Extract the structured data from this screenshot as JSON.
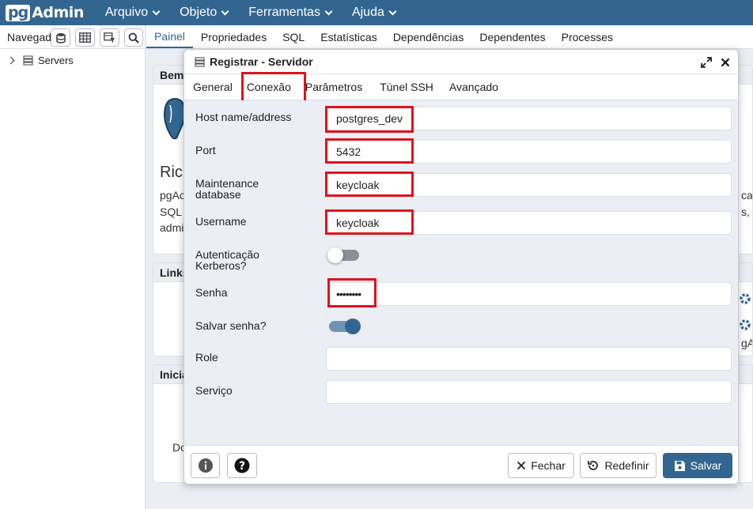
{
  "app": {
    "logo_pg": "pg",
    "logo_admin": "Admin"
  },
  "menu": [
    {
      "label": "Arquivo"
    },
    {
      "label": "Objeto"
    },
    {
      "label": "Ferramentas"
    },
    {
      "label": "Ajuda"
    }
  ],
  "browser": {
    "title": "Navegador",
    "tree": [
      {
        "label": "Servers",
        "icon": "server-group-icon",
        "expanded": false
      }
    ]
  },
  "main_tabs": [
    {
      "label": "Painel",
      "active": true
    },
    {
      "label": "Propriedades"
    },
    {
      "label": "SQL"
    },
    {
      "label": "Estatísticas"
    },
    {
      "label": "Dependências"
    },
    {
      "label": "Dependentes"
    },
    {
      "label": "Processes"
    }
  ],
  "dashboard": {
    "welcome_head": "Bem-",
    "welcome_big": "Ric",
    "welcome_lines": [
      "pgAc",
      "SQL",
      "admi"
    ],
    "welcome_right": [
      "cal",
      "s, l"
    ],
    "links_head": "Links",
    "links_right": "gA",
    "start_head": "Inicia",
    "start_bottom": "Do"
  },
  "dialog": {
    "title": "Registrar - Servidor",
    "tabs": [
      {
        "label": "General"
      },
      {
        "label": "Conexão",
        "active": true
      },
      {
        "label": "Parâmetros"
      },
      {
        "label": "Túnel SSH"
      },
      {
        "label": "Avançado"
      }
    ],
    "fields": {
      "host": {
        "label": "Host name/address",
        "value": "postgres_dev"
      },
      "port": {
        "label": "Port",
        "value": "5432"
      },
      "maintenance_db": {
        "label": "Maintenance database",
        "label_line1": "Maintenance",
        "label_line2": "database",
        "value": "keycloak"
      },
      "username": {
        "label": "Username",
        "value": "keycloak"
      },
      "kerberos": {
        "label": "Autenticação Kerberos?",
        "label_line1": "Autenticação",
        "label_line2": "Kerberos?",
        "checked": false
      },
      "password": {
        "label": "Senha",
        "value": "••••••••"
      },
      "save_password": {
        "label": "Salvar senha?",
        "checked": true
      },
      "role": {
        "label": "Role",
        "value": ""
      },
      "service": {
        "label": "Serviço",
        "value": ""
      }
    },
    "footer": {
      "close": "Fechar",
      "reset": "Redefinir",
      "save": "Salvar"
    }
  },
  "colors": {
    "brand": "#326690",
    "highlight": "#e0121c",
    "toggle_on": "#326690",
    "toggle_off": "#8a8f96"
  }
}
